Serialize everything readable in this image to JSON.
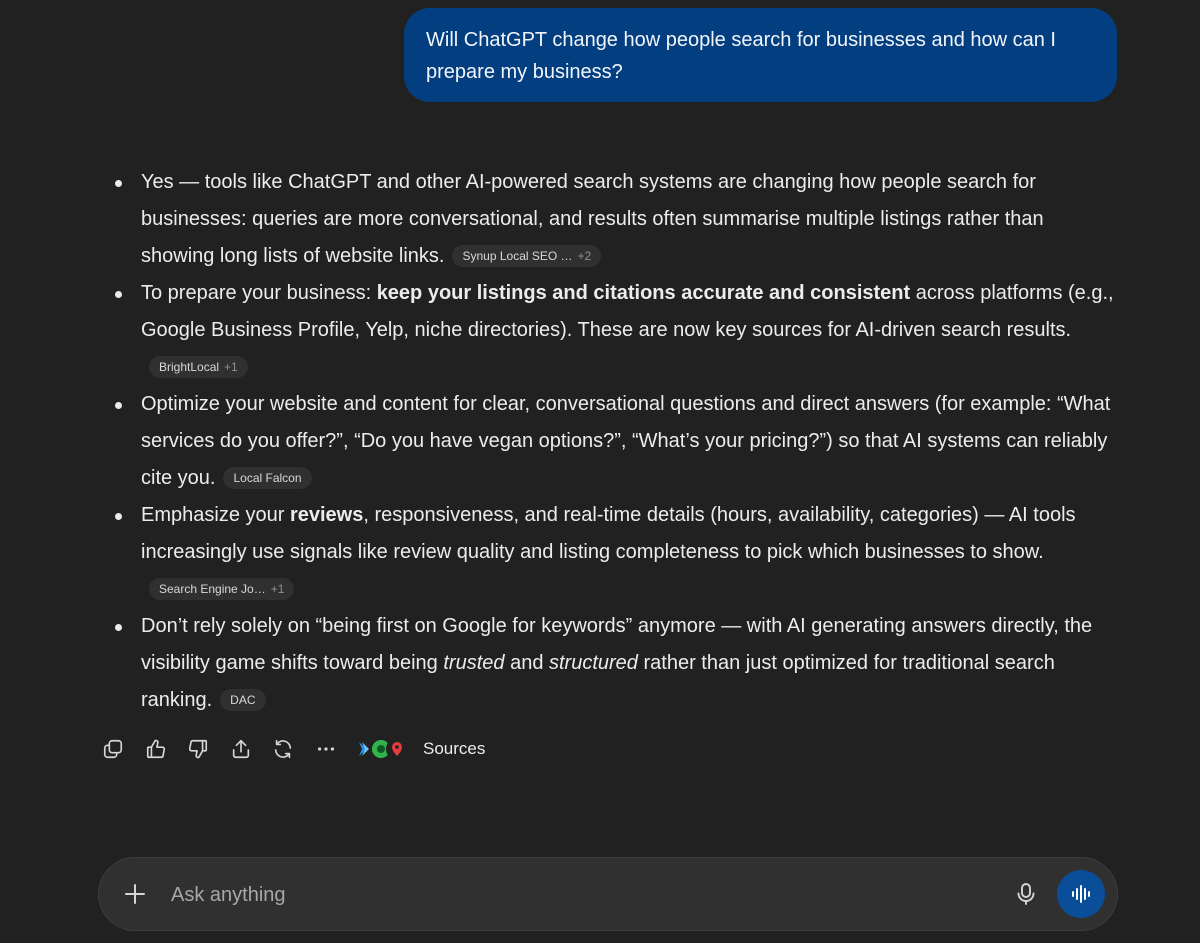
{
  "user_message": "Will ChatGPT change how people search for businesses and how can I prepare my business?",
  "answer": {
    "items": [
      {
        "parts": [
          {
            "text": "Yes — tools like ChatGPT and other AI-powered search systems are changing how people search for businesses: queries are more conversational, and results often summarise multiple listings rather than showing long lists of website links."
          }
        ],
        "source": {
          "label": "Synup Local SEO …",
          "more": "+2"
        }
      },
      {
        "parts": [
          {
            "text": "To prepare your business: "
          },
          {
            "text": "keep your listings and citations accurate and consistent",
            "bold": true
          },
          {
            "text": " across platforms (e.g., Google Business Profile, Yelp, niche directories). These are now key sources for AI-driven search results."
          }
        ],
        "source": {
          "label": "BrightLocal",
          "more": "+1"
        }
      },
      {
        "parts": [
          {
            "text": "Optimize your website and content for clear, conversational questions and direct answers (for example: “What services do you offer?”, “Do you have vegan options?”, “What’s your pricing?”) so that AI systems can reliably cite you."
          }
        ],
        "source": {
          "label": "Local Falcon",
          "more": ""
        }
      },
      {
        "parts": [
          {
            "text": "Emphasize your "
          },
          {
            "text": "reviews",
            "bold": true
          },
          {
            "text": ", responsiveness, and real-time details (hours, availability, categories) — AI tools increasingly use signals like review quality and listing completeness to pick which businesses to show."
          }
        ],
        "source": {
          "label": "Search Engine Jo…",
          "more": "+1"
        }
      },
      {
        "parts": [
          {
            "text": "Don’t rely solely on “being first on Google for keywords” anymore — with AI generating answers directly, the visibility game shifts toward being "
          },
          {
            "text": "trusted",
            "italic": true
          },
          {
            "text": " and "
          },
          {
            "text": "structured",
            "italic": true
          },
          {
            "text": " rather than just optimized for traditional search ranking."
          }
        ],
        "source": {
          "label": "DAC",
          "more": ""
        }
      }
    ]
  },
  "actions": {
    "icons": [
      "copy-icon",
      "thumbs-up-icon",
      "thumbs-down-icon",
      "share-icon",
      "regenerate-icon",
      "more-icon"
    ],
    "sources_label": "Sources"
  },
  "composer": {
    "placeholder": "Ask anything"
  },
  "colors": {
    "background": "#212121",
    "user_bubble": "#033f80",
    "chip_bg": "#303030",
    "voice_button": "#0a4d99"
  }
}
